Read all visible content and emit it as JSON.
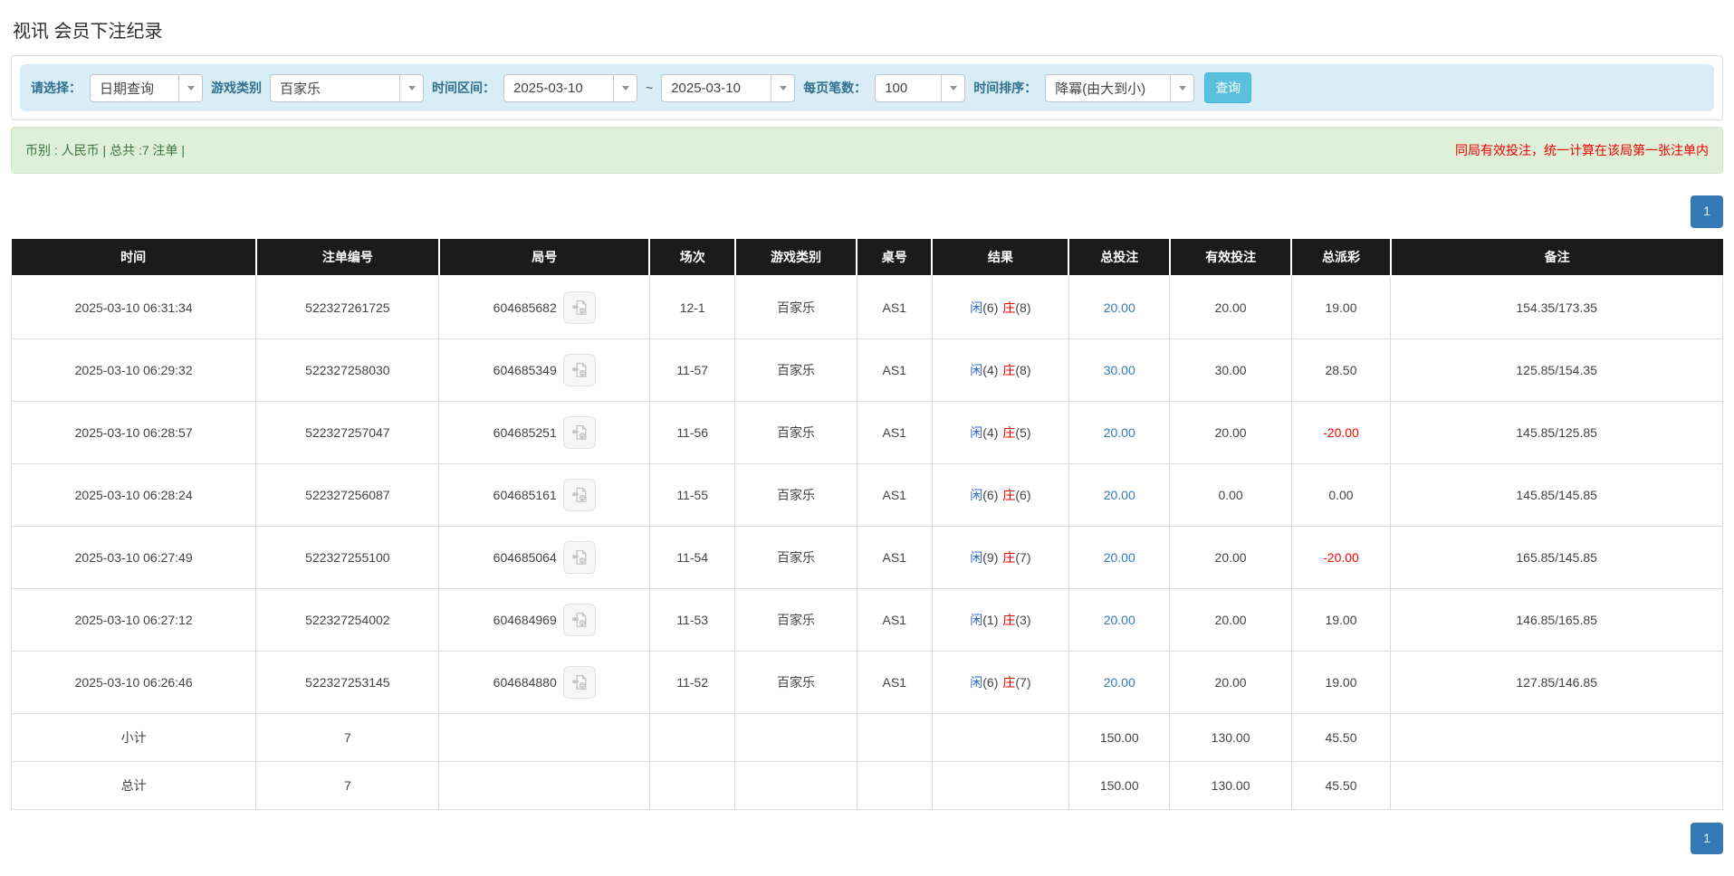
{
  "page_title": "视讯 会员下注纪录",
  "filters": {
    "select_label": "请选择：",
    "select_value": "日期查询",
    "game_type_label": "游戏类别",
    "game_type_value": "百家乐",
    "date_range_label": "时间区间：",
    "date_from": "2025-03-10",
    "date_separator": "~",
    "date_to": "2025-03-10",
    "page_size_label": "每页笔数：",
    "page_size_value": "100",
    "sort_label": "时间排序：",
    "sort_value": "降冪(由大到小)",
    "search_button": "查询"
  },
  "summary_bar": {
    "left": "币别 : 人民币 | 总共 :7 注单 |",
    "right": "同局有效投注，统一计算在该局第一张注单内"
  },
  "pagination": {
    "page_label": "1"
  },
  "table": {
    "headers": [
      "时间",
      "注单编号",
      "局号",
      "场次",
      "游戏类别",
      "桌号",
      "结果",
      "总投注",
      "有效投注",
      "总派彩",
      "备注"
    ],
    "rows": [
      {
        "time": "2025-03-10 06:31:34",
        "bet_no": "522327261725",
        "round_no": "604685682",
        "session": "12-1",
        "game": "百家乐",
        "table_no": "AS1",
        "player": "闲",
        "player_score": "(6)",
        "banker": "庄",
        "banker_score": "(8)",
        "total_bet": "20.00",
        "valid_bet": "20.00",
        "payout": "19.00",
        "payout_negative": false,
        "remark": "154.35/173.35"
      },
      {
        "time": "2025-03-10 06:29:32",
        "bet_no": "522327258030",
        "round_no": "604685349",
        "session": "11-57",
        "game": "百家乐",
        "table_no": "AS1",
        "player": "闲",
        "player_score": "(4)",
        "banker": "庄",
        "banker_score": "(8)",
        "total_bet": "30.00",
        "valid_bet": "30.00",
        "payout": "28.50",
        "payout_negative": false,
        "remark": "125.85/154.35"
      },
      {
        "time": "2025-03-10 06:28:57",
        "bet_no": "522327257047",
        "round_no": "604685251",
        "session": "11-56",
        "game": "百家乐",
        "table_no": "AS1",
        "player": "闲",
        "player_score": "(4)",
        "banker": "庄",
        "banker_score": "(5)",
        "total_bet": "20.00",
        "valid_bet": "20.00",
        "payout": "-20.00",
        "payout_negative": true,
        "remark": "145.85/125.85"
      },
      {
        "time": "2025-03-10 06:28:24",
        "bet_no": "522327256087",
        "round_no": "604685161",
        "session": "11-55",
        "game": "百家乐",
        "table_no": "AS1",
        "player": "闲",
        "player_score": "(6)",
        "banker": "庄",
        "banker_score": "(6)",
        "total_bet": "20.00",
        "valid_bet": "0.00",
        "payout": "0.00",
        "payout_negative": false,
        "remark": "145.85/145.85"
      },
      {
        "time": "2025-03-10 06:27:49",
        "bet_no": "522327255100",
        "round_no": "604685064",
        "session": "11-54",
        "game": "百家乐",
        "table_no": "AS1",
        "player": "闲",
        "player_score": "(9)",
        "banker": "庄",
        "banker_score": "(7)",
        "total_bet": "20.00",
        "valid_bet": "20.00",
        "payout": "-20.00",
        "payout_negative": true,
        "remark": "165.85/145.85"
      },
      {
        "time": "2025-03-10 06:27:12",
        "bet_no": "522327254002",
        "round_no": "604684969",
        "session": "11-53",
        "game": "百家乐",
        "table_no": "AS1",
        "player": "闲",
        "player_score": "(1)",
        "banker": "庄",
        "banker_score": "(3)",
        "total_bet": "20.00",
        "valid_bet": "20.00",
        "payout": "19.00",
        "payout_negative": false,
        "remark": "146.85/165.85"
      },
      {
        "time": "2025-03-10 06:26:46",
        "bet_no": "522327253145",
        "round_no": "604684880",
        "session": "11-52",
        "game": "百家乐",
        "table_no": "AS1",
        "player": "闲",
        "player_score": "(6)",
        "banker": "庄",
        "banker_score": "(7)",
        "total_bet": "20.00",
        "valid_bet": "20.00",
        "payout": "19.00",
        "payout_negative": false,
        "remark": "127.85/146.85"
      }
    ],
    "summary_rows": [
      {
        "label": "小计",
        "count": "7",
        "total_bet": "150.00",
        "valid_bet": "130.00",
        "payout": "45.50"
      },
      {
        "label": "总计",
        "count": "7",
        "total_bet": "150.00",
        "valid_bet": "130.00",
        "payout": "45.50"
      }
    ]
  },
  "icons": {
    "dropdown": "chevron-down-icon",
    "video": "video-replay-icon"
  },
  "colors": {
    "header_bg": "#1b1b1b",
    "filter_bar_bg": "#d9edf7",
    "summary_bar_bg": "#dff0d8",
    "link_blue": "#337ab7",
    "player_blue": "#3366cc",
    "banker_red": "#e60000",
    "negative_red": "#ff0000",
    "subtotal_gray": "#8f8f8f"
  }
}
